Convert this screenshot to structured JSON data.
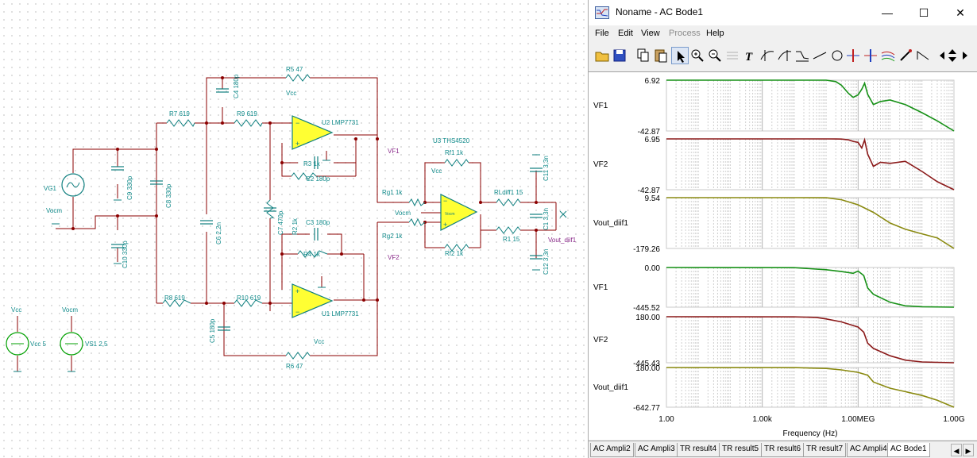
{
  "colors": {
    "wire": "#8b0000",
    "component": "#0f7f7f",
    "opamp_fill": "#ffff33",
    "net_label": "#8a2a8a",
    "trace_green": "#179117",
    "trace_darkred": "#8b1a1a",
    "trace_olive": "#8a8a10",
    "source_green": "#00a000"
  },
  "schematic": {
    "components": {
      "r5": "R5 47",
      "c4": "C4 180p",
      "r9": "R9 619",
      "r7": "R7 619",
      "u2": "U2 LMP7731",
      "vcc_u2": "Vcc",
      "r3": "R3 1k",
      "c2": "C2 180p",
      "vg1": "VG1",
      "c9": "C9 330p",
      "c8": "C8 330p",
      "vocm_left": "Vocm",
      "c10": "C10 330p",
      "c6": "C6 2,2n",
      "c7": "C7 470p",
      "r2": "R2 1k",
      "c3": "C3 180p",
      "r4": "R4 1k",
      "r8": "R8 619",
      "r10": "R10 619",
      "u1": "U1 LMP7731",
      "vcc_u1": "Vcc",
      "c5": "C5 180p",
      "r6": "R6 47",
      "vcc_src_label": "Vcc",
      "vcc_src_value": "Vcc 5",
      "vocm_src_label": "Vocm",
      "vs1_value": "VS1 2,5",
      "u3": "U3 THS4520",
      "rf1": "Rf1 1k",
      "vcc_u3": "Vcc",
      "rg1": "Rg1 1k",
      "vocm_u3": "Vocm",
      "rg2": "Rg2 1k",
      "rf2": "Rf2 1k",
      "rldiff1": "RLdiff1 15",
      "r1": "R1 15",
      "c11": "C11 3,3n",
      "c1": "C1 3,3n",
      "c12": "C12 3,3n",
      "opamp_inner": "Vocm"
    },
    "nets": {
      "vf1": "VF1",
      "vf2": "VF2",
      "vout": "Vout_diif1"
    }
  },
  "window": {
    "title": "Noname - AC Bode1",
    "buttons": {
      "minimize": "—",
      "maximize": "☐",
      "close": "✕"
    },
    "menu": [
      {
        "label": "File",
        "enabled": true
      },
      {
        "label": "Edit",
        "enabled": true
      },
      {
        "label": "View",
        "enabled": true
      },
      {
        "label": "Process",
        "enabled": false
      },
      {
        "label": "Help",
        "enabled": true
      }
    ],
    "toolbar_icons": [
      "open-folder-icon",
      "save-icon",
      "copy-icon",
      "paste-icon",
      "pointer-icon",
      "zoom-in-icon",
      "zoom-out-icon",
      "grid-icon",
      "text-icon",
      "cursor-a-icon",
      "cursor-b-icon",
      "graph-icon",
      "line-icon",
      "circle-icon",
      "marker-a-icon",
      "marker-b-icon",
      "traces-icon",
      "pen-icon",
      "arrow-icon",
      "scroll-left-icon",
      "scroll-updown-icon",
      "scroll-right-icon"
    ],
    "tabs": [
      {
        "label": "AC Ampli2",
        "active": false
      },
      {
        "label": "AC Ampli3",
        "active": false
      },
      {
        "label": "TR result4",
        "active": false
      },
      {
        "label": "TR result5",
        "active": false
      },
      {
        "label": "TR result6",
        "active": false
      },
      {
        "label": "TR result7",
        "active": false
      },
      {
        "label": "AC Ampli4",
        "active": false
      },
      {
        "label": "AC Bode1",
        "active": true
      }
    ]
  },
  "chart_data": {
    "type": "line",
    "xscale": "log",
    "xlabel": "Frequency (Hz)",
    "xlim": [
      1,
      1000000000
    ],
    "xtick_labels": [
      "1.00",
      "1.00k",
      "1.00MEG",
      "1.00G"
    ],
    "grid": true,
    "panels": [
      {
        "name": "VF1",
        "kind": "amplitude",
        "ylim": [
          -42.87,
          6.92
        ],
        "ytick_labels": [
          "6.92",
          "-42.87"
        ],
        "color": "#179117",
        "x": [
          1,
          10000,
          100000,
          200000,
          300000,
          500000,
          700000,
          1000000,
          1300000,
          1600000,
          2000000,
          3000000,
          5000000,
          10000000,
          30000000,
          100000000,
          300000000,
          1000000000
        ],
        "y": [
          6.92,
          6.92,
          6.9,
          5.5,
          2.0,
          -6.0,
          -10.0,
          -7.5,
          -2.0,
          4.0,
          -7.0,
          -17.0,
          -14.0,
          -12.5,
          -17.0,
          -25.0,
          -33.0,
          -42.87
        ]
      },
      {
        "name": "VF2",
        "kind": "amplitude",
        "ylim": [
          -42.87,
          6.95
        ],
        "ytick_labels": [
          "6.95",
          "-42.87"
        ],
        "color": "#8b1a1a",
        "x": [
          1,
          10000,
          100000,
          200000,
          300000,
          500000,
          700000,
          1000000,
          1300000,
          1600000,
          2000000,
          3000000,
          5000000,
          10000000,
          30000000,
          100000000,
          300000000,
          1000000000
        ],
        "y": [
          6.95,
          6.95,
          6.95,
          6.9,
          6.8,
          6.0,
          4.5,
          3.5,
          -2.0,
          6.0,
          -8.0,
          -20.0,
          -16.0,
          -17.0,
          -15.0,
          -25.0,
          -35.0,
          -42.87
        ]
      },
      {
        "name": "Vout_diif1",
        "kind": "amplitude",
        "ylim": [
          -179.26,
          9.54
        ],
        "ytick_labels": [
          "9.54",
          "-179.26"
        ],
        "color": "#8a8a10",
        "x": [
          1,
          10000,
          100000,
          300000,
          1000000,
          3000000,
          10000000,
          30000000,
          100000000,
          300000000,
          1000000000
        ],
        "y": [
          9.54,
          9.54,
          9.3,
          2.0,
          -17.0,
          -45.0,
          -85.0,
          -108.0,
          -125.0,
          -140.0,
          -179.26
        ]
      },
      {
        "name": "VF1",
        "kind": "phase",
        "ylim": [
          -445.52,
          0.0
        ],
        "ytick_labels": [
          "0.00",
          "-445.52"
        ],
        "color": "#179117",
        "x": [
          1,
          10000,
          100000,
          300000,
          700000,
          1000000,
          1500000,
          2000000,
          3000000,
          10000000,
          30000000,
          100000000,
          1000000000
        ],
        "y": [
          0.0,
          -2.0,
          -25.0,
          -45.0,
          -65.0,
          -40.0,
          -90.0,
          -230.0,
          -300.0,
          -390.0,
          -430.0,
          -440.0,
          -445.52
        ]
      },
      {
        "name": "VF2",
        "kind": "phase",
        "ylim": [
          -445.43,
          180.0
        ],
        "ytick_labels": [
          "180.00",
          "-445.43"
        ],
        "color": "#8b1a1a",
        "x": [
          1,
          10000,
          50000,
          100000,
          300000,
          700000,
          1000000,
          1500000,
          2000000,
          3000000,
          10000000,
          30000000,
          100000000,
          1000000000
        ],
        "y": [
          180.0,
          178.0,
          170.0,
          150.0,
          110.0,
          60.0,
          40.0,
          -30.0,
          -180.0,
          -250.0,
          -350.0,
          -410.0,
          -435.0,
          -445.43
        ]
      },
      {
        "name": "Vout_diif1",
        "kind": "phase",
        "ylim": [
          -642.77,
          180.0
        ],
        "ytick_labels": [
          "180.00",
          "-642.77"
        ],
        "color": "#8a8a10",
        "x": [
          1,
          10000,
          100000,
          300000,
          1000000,
          2000000,
          3000000,
          10000000,
          30000000,
          100000000,
          300000000,
          1000000000
        ],
        "y": [
          180.0,
          178.0,
          160.0,
          130.0,
          80.0,
          20.0,
          -120.0,
          -250.0,
          -320.0,
          -400.0,
          -500.0,
          -642.77
        ]
      }
    ]
  }
}
